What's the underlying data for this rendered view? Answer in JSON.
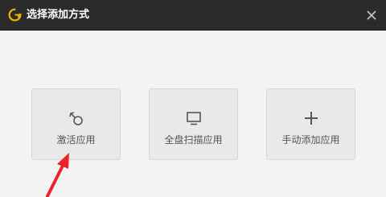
{
  "window": {
    "title": "选择添加方式",
    "logo_icon": "g-logo-icon",
    "close_icon": "close-icon",
    "accent_color": "#f2b400"
  },
  "options": [
    {
      "label": "激活应用",
      "icon": "rotate-link-icon"
    },
    {
      "label": "全盘扫描应用",
      "icon": "monitor-icon"
    },
    {
      "label": "手动添加应用",
      "icon": "plus-icon"
    }
  ],
  "annotation": {
    "arrow_color": "#e8242a",
    "arrow_icon": "red-arrow-pointer"
  }
}
